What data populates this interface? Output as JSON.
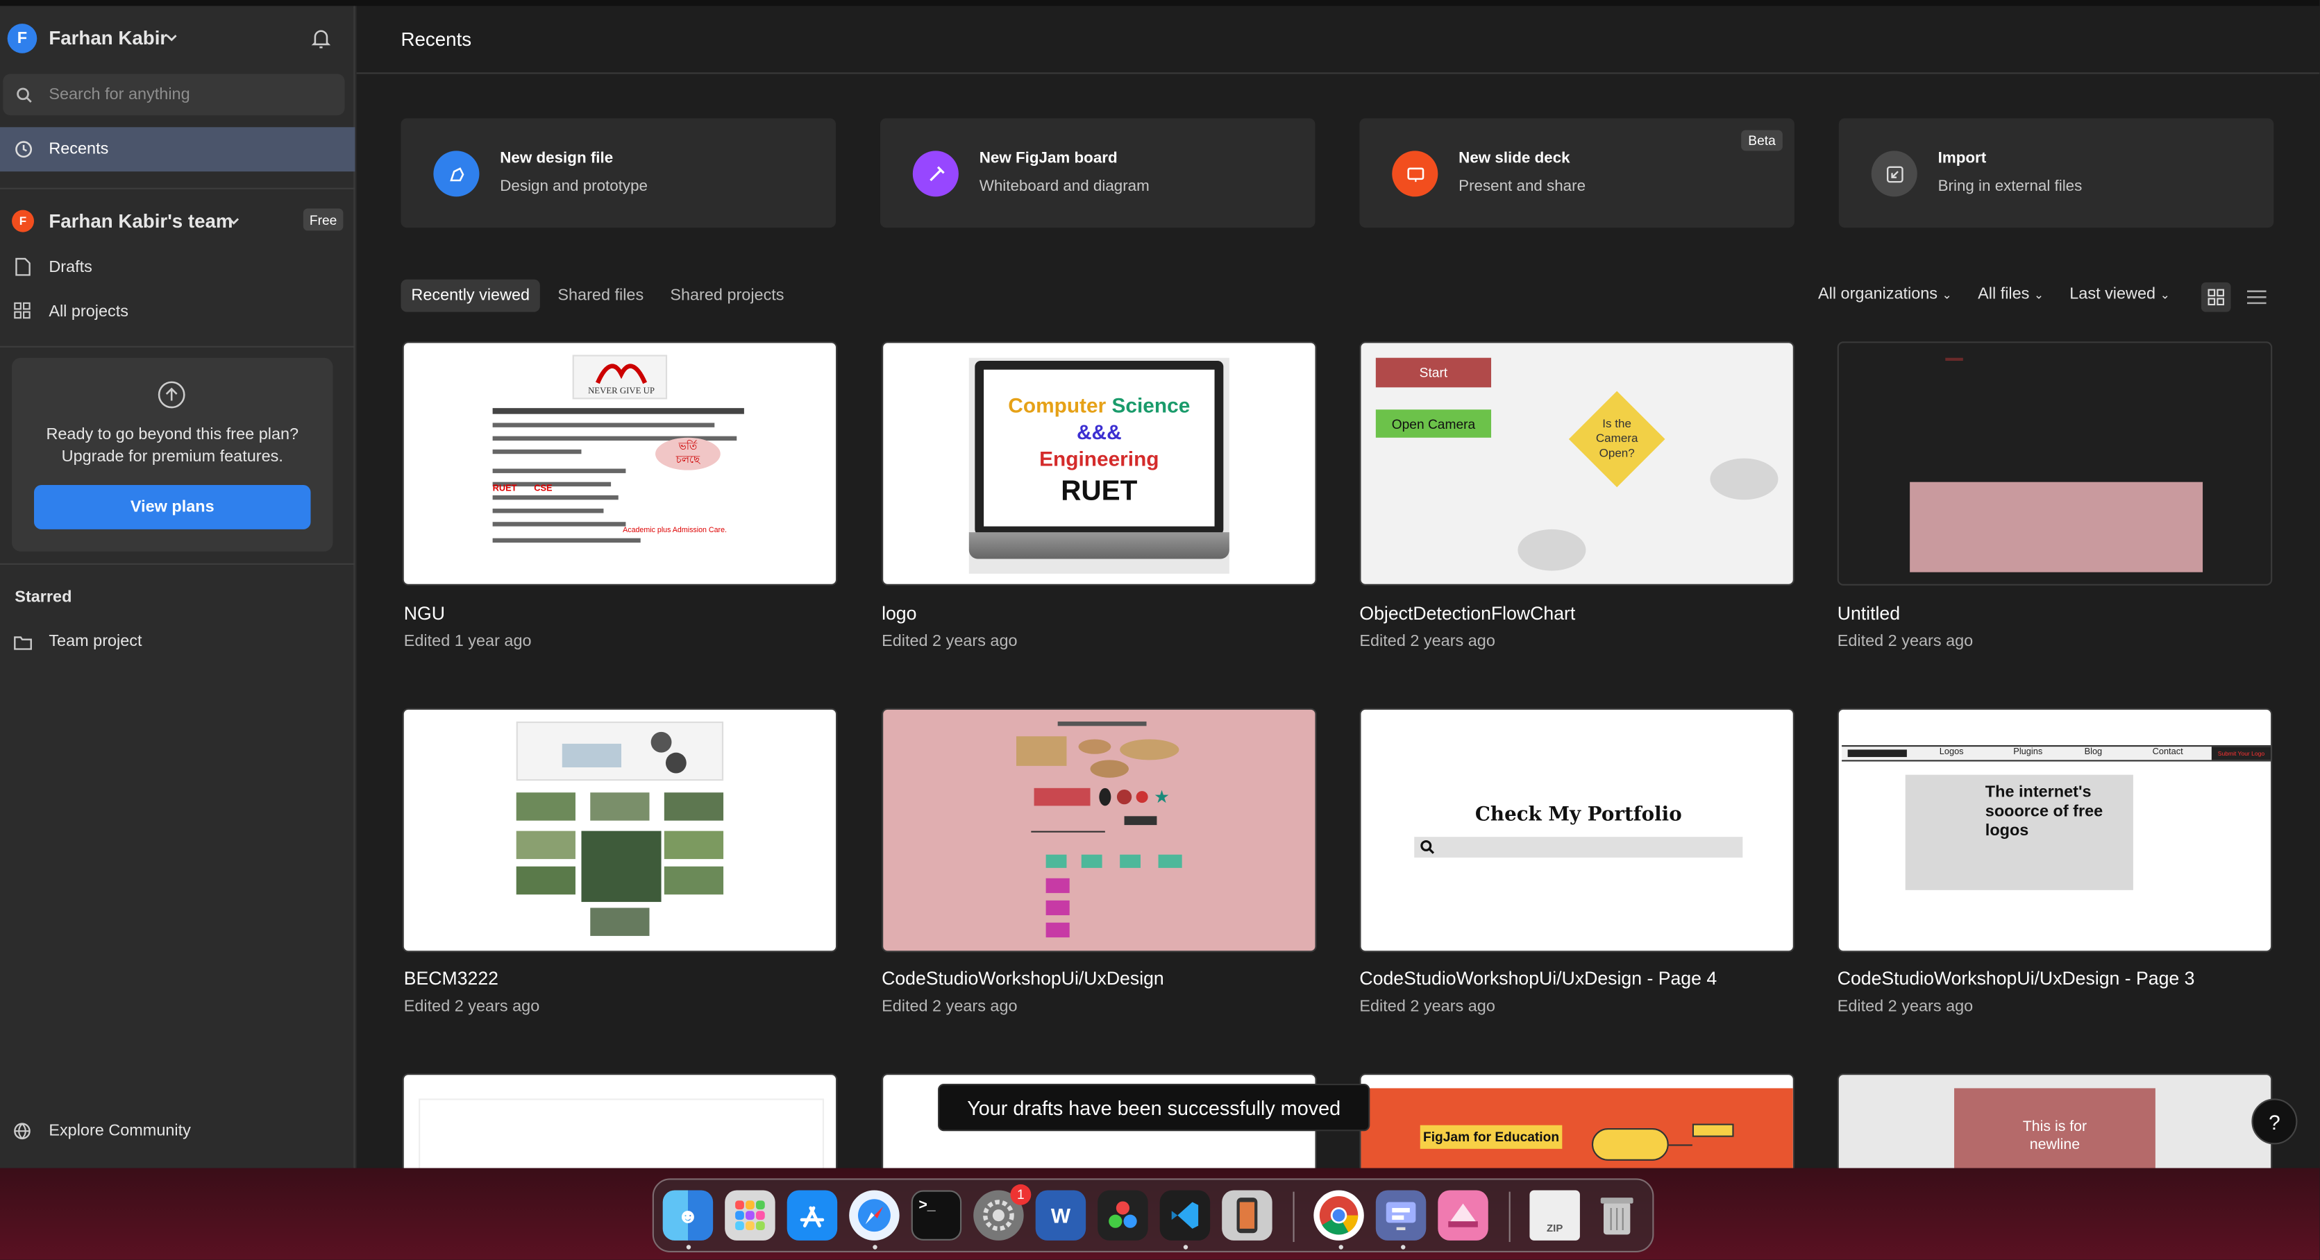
{
  "user": {
    "initial": "F",
    "name": "Farhan Kabir"
  },
  "search": {
    "placeholder": "Search for anything"
  },
  "nav": {
    "recents": "Recents",
    "team_initial": "F",
    "team": "Farhan Kabir's team",
    "team_badge": "Free",
    "drafts": "Drafts",
    "all_projects": "All projects"
  },
  "upgrade": {
    "line1": "Ready to go beyond this free plan?",
    "line2": "Upgrade for premium features.",
    "button": "View plans"
  },
  "starred": {
    "heading": "Starred",
    "item": "Team project"
  },
  "explore": "Explore Community",
  "header": {
    "title": "Recents"
  },
  "cards": [
    {
      "title": "New design file",
      "subtitle": "Design and prototype",
      "color": "#2f80ed",
      "icon": "design-file-icon"
    },
    {
      "title": "New FigJam board",
      "subtitle": "Whiteboard and diagram",
      "color": "#9747ff",
      "icon": "figjam-icon"
    },
    {
      "title": "New slide deck",
      "subtitle": "Present and share",
      "color": "#f24e1e",
      "icon": "slide-deck-icon",
      "badge": "Beta"
    },
    {
      "title": "Import",
      "subtitle": "Bring in external files",
      "color": "#4a4a4a",
      "icon": "import-icon"
    }
  ],
  "tabs": [
    "Recently viewed",
    "Shared files",
    "Shared projects"
  ],
  "filters": {
    "org": "All organizations",
    "files": "All files",
    "sort": "Last viewed"
  },
  "files": [
    {
      "name": "NGU",
      "edited": "Edited 1 year ago"
    },
    {
      "name": "logo",
      "edited": "Edited 2 years ago"
    },
    {
      "name": "ObjectDetectionFlowChart",
      "edited": "Edited 2 years ago"
    },
    {
      "name": "Untitled",
      "edited": "Edited 2 years ago"
    },
    {
      "name": "BECM3222",
      "edited": "Edited 2 years ago"
    },
    {
      "name": "CodeStudioWorkshopUi/UxDesign",
      "edited": "Edited 2 years ago"
    },
    {
      "name": "CodeStudioWorkshopUi/UxDesign - Page 4",
      "edited": "Edited 2 years ago"
    },
    {
      "name": "CodeStudioWorkshopUi/UxDesign - Page 3",
      "edited": "Edited 2 years ago"
    }
  ],
  "thumbs": {
    "ngu": {
      "logo": "NEVER GIVE UP",
      "badge1": "ভর্তি",
      "badge2": "চলছে",
      "ruet": "RUET",
      "cse": "CSE",
      "academic": "Academic plus Admission Care."
    },
    "logo": {
      "line1a": "Computer",
      "line1b": "Science",
      "line2": "&&&",
      "line3": "Engineering",
      "line4": "RUET"
    },
    "flow": {
      "start": "Start",
      "open_camera": "Open Camera",
      "decision": "Is the Camera Open?"
    },
    "portfolio": {
      "title": "Check My Portfolio"
    },
    "page3": {
      "nav": [
        "Logos",
        "Plugins",
        "Blog",
        "Contact"
      ],
      "cta": "Submit Your Logo",
      "headline": "The internet's sooorce of free logos"
    },
    "figjam_edu": "FigJam for Education",
    "newline": "This is for newline"
  },
  "toast": "Your drafts have been successfully moved",
  "help": "?",
  "dock": {
    "notification_count": "1",
    "zip_label": "ZIP"
  }
}
